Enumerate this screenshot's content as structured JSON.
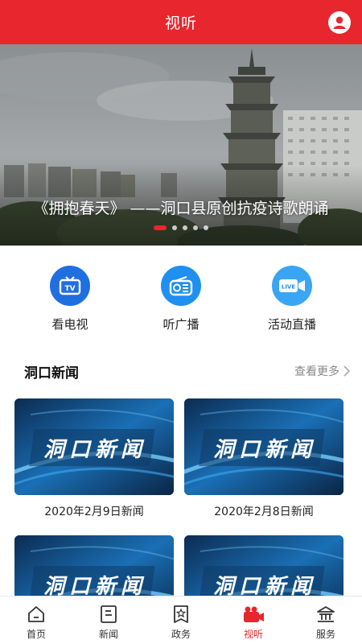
{
  "header": {
    "title": "视听"
  },
  "banner": {
    "caption": "《拥抱春天》 ——洞口县原创抗疫诗歌朗诵",
    "slide_count": 5,
    "active_slide": 1
  },
  "quick_menu": [
    {
      "label": "看电视",
      "icon": "tv-icon",
      "color": "#1f6fe0"
    },
    {
      "label": "听广播",
      "icon": "radio-icon",
      "color": "#1f8ff0"
    },
    {
      "label": "活动直播",
      "icon": "live-icon",
      "color": "#3aa5f5"
    }
  ],
  "news_section": {
    "title": "洞口新闻",
    "more_label": "查看更多",
    "items": [
      {
        "title": "2020年2月9日新闻",
        "thumb_text": "洞口新闻"
      },
      {
        "title": "2020年2月8日新闻",
        "thumb_text": "洞口新闻"
      },
      {
        "title": "",
        "thumb_text": "洞口新闻"
      },
      {
        "title": "",
        "thumb_text": "洞口新闻"
      }
    ]
  },
  "bottom_nav": [
    {
      "label": "首页",
      "icon": "home-icon"
    },
    {
      "label": "新闻",
      "icon": "news-icon"
    },
    {
      "label": "政务",
      "icon": "government-icon"
    },
    {
      "label": "视听",
      "icon": "video-icon",
      "active": true
    },
    {
      "label": "服务",
      "icon": "service-icon"
    }
  ],
  "colors": {
    "brand_red": "#e8262d",
    "inactive_text": "#333333"
  }
}
